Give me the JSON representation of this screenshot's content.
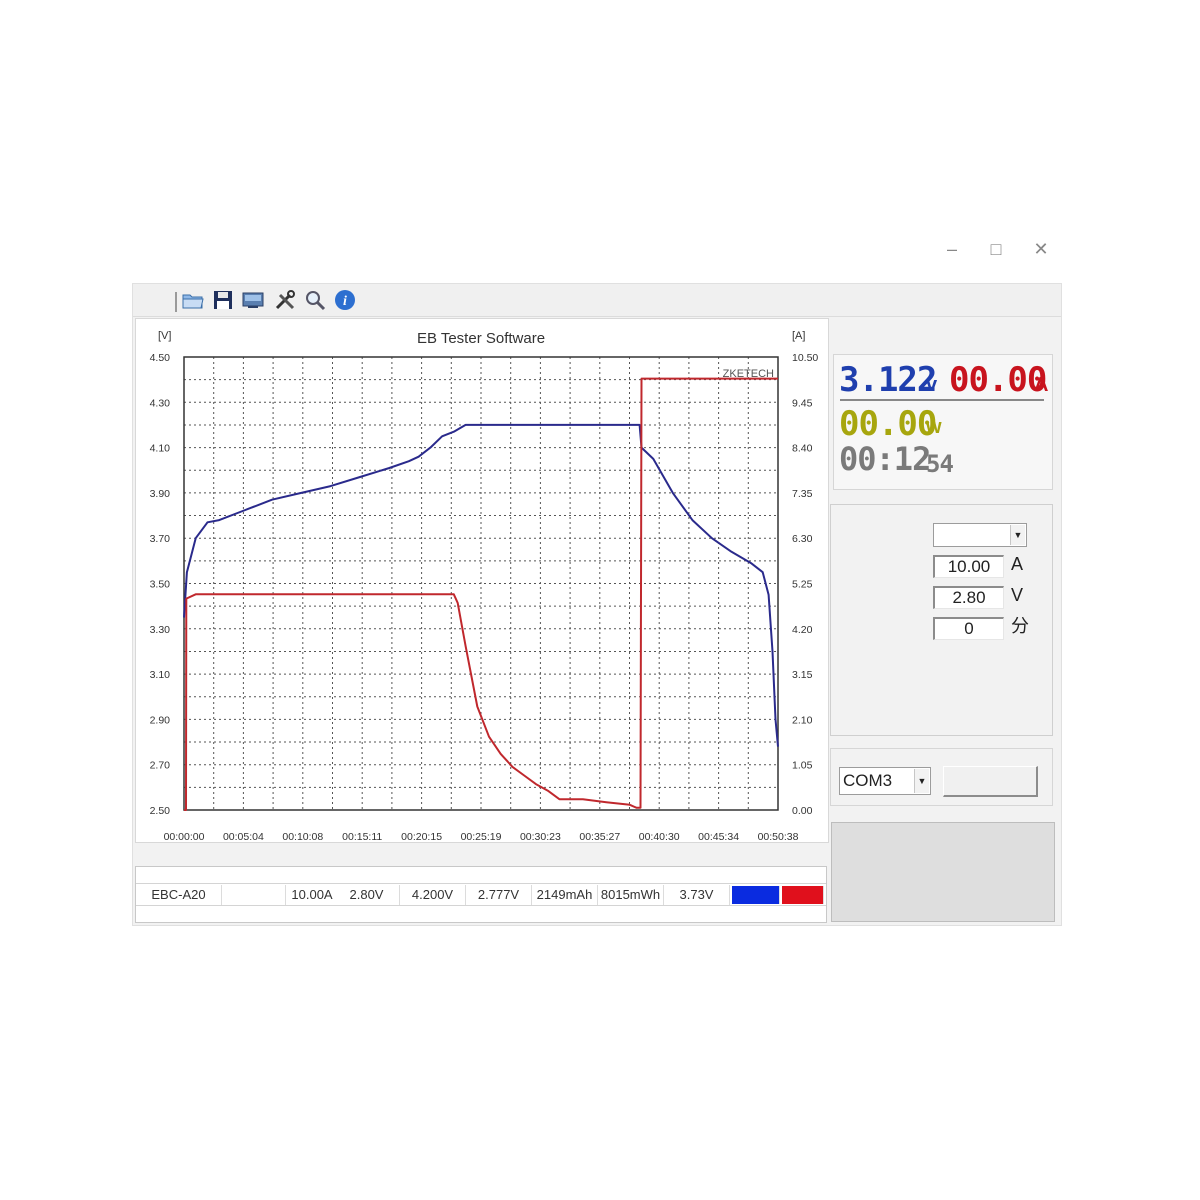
{
  "window_controls": {
    "minimize": "–",
    "maximize": "□",
    "close": "✕"
  },
  "toolbar": {
    "icons": [
      "open-folder-icon",
      "save-icon",
      "monitor-icon",
      "tools-icon",
      "zoom-icon",
      "info-icon"
    ]
  },
  "chart_data": {
    "type": "line",
    "title": "EB Tester Software",
    "ylabel_left": "[V]",
    "ylabel_right": "[A]",
    "watermark": "ZKETECH",
    "y_left_ticks": [
      "4.50",
      "4.30",
      "4.10",
      "3.90",
      "3.70",
      "3.50",
      "3.30",
      "3.10",
      "2.90",
      "2.70",
      "2.50"
    ],
    "y_right_ticks": [
      "10.50",
      "9.45",
      "8.40",
      "7.35",
      "6.30",
      "5.25",
      "4.20",
      "3.15",
      "2.10",
      "1.05",
      "0.00"
    ],
    "x_ticks": [
      "00:00:00",
      "00:05:04",
      "00:10:08",
      "00:15:11",
      "00:20:15",
      "00:25:19",
      "00:30:23",
      "00:35:27",
      "00:40:30",
      "00:45:34",
      "00:50:38"
    ],
    "ylim_left": [
      2.5,
      4.5
    ],
    "ylim_right": [
      0,
      10.5
    ],
    "xlim_seconds": [
      0,
      3038
    ],
    "grid": true,
    "series": [
      {
        "axis": "left",
        "color": "#2a2a8c",
        "x_seconds": [
          0,
          15,
          60,
          120,
          180,
          300,
          450,
          600,
          750,
          900,
          1050,
          1150,
          1200,
          1260,
          1320,
          1380,
          1440,
          1500,
          1620,
          1800,
          2000,
          2200,
          2330,
          2340,
          2400,
          2500,
          2600,
          2700,
          2800,
          2900,
          2960,
          2990,
          3010,
          3025,
          3038
        ],
        "values": [
          3.35,
          3.55,
          3.7,
          3.77,
          3.78,
          3.82,
          3.87,
          3.9,
          3.93,
          3.97,
          4.01,
          4.04,
          4.06,
          4.1,
          4.15,
          4.17,
          4.2,
          4.2,
          4.2,
          4.2,
          4.2,
          4.2,
          4.2,
          4.1,
          4.05,
          3.9,
          3.78,
          3.7,
          3.64,
          3.59,
          3.55,
          3.45,
          3.2,
          2.9,
          2.78
        ]
      },
      {
        "axis": "right",
        "color": "#c0282d",
        "x_seconds": [
          0,
          10,
          12,
          60,
          1380,
          1400,
          1440,
          1500,
          1560,
          1620,
          1680,
          1740,
          1800,
          1860,
          1920,
          2040,
          2160,
          2280,
          2315,
          2320,
          2330,
          2335,
          2340,
          3038
        ],
        "values": [
          0,
          0,
          4.9,
          5.0,
          5.0,
          4.8,
          3.8,
          2.4,
          1.7,
          1.3,
          1.0,
          0.8,
          0.6,
          0.45,
          0.25,
          0.25,
          0.18,
          0.12,
          0.05,
          0.05,
          0.05,
          0.05,
          10.0,
          10.0
        ]
      }
    ]
  },
  "lcd": {
    "voltage": "3.122",
    "voltage_unit": "v",
    "current": "00.00",
    "current_unit": "A",
    "power": "00.00",
    "power_unit": "w",
    "time": "00:12",
    "time_seconds": "54",
    "colors": {
      "voltage": "#1f3fae",
      "current": "#c8141e",
      "power": "#a7a60e",
      "time": "#7a7a7a"
    }
  },
  "settings": {
    "mode_value": "",
    "current_value": "10.00",
    "current_unit": "A",
    "voltage_value": "2.80",
    "voltage_unit": "V",
    "minutes_value": "0",
    "minutes_unit": "分"
  },
  "com": {
    "port": "COM3"
  },
  "status_row": {
    "model": "EBC-A20",
    "set_current": "10.00A",
    "set_voltage": "2.80V",
    "charge_voltage": "4.200V",
    "end_voltage": "2.777V",
    "capacity": "2149mAh",
    "energy": "8015mWh",
    "avg_voltage": "3.73V",
    "color_blue": "#0a2be0",
    "color_red": "#e0101c"
  }
}
